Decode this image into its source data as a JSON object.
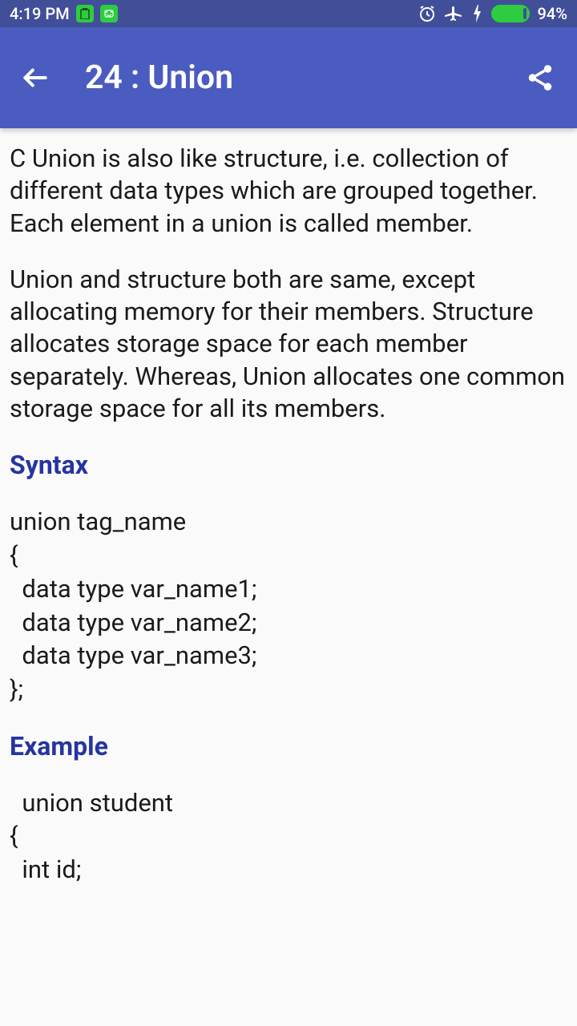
{
  "status": {
    "time": "4:19 PM",
    "battery_text": "94%"
  },
  "appbar": {
    "title": "24 :  Union"
  },
  "content": {
    "para1": "C Union is also like structure, i.e. collection of different data types which are grouped together. Each element in a union is called member.",
    "para2": "Union and structure both are same, except allocating memory for their members. Structure allocates storage space for each member separately. Whereas, Union allocates one common storage space for all its members.",
    "syntax_heading": "Syntax",
    "syntax_l1": "union tag_name",
    "syntax_l2": "{",
    "syntax_l3": "  data type var_name1;",
    "syntax_l4": "  data type var_name2;",
    "syntax_l5": "  data type var_name3;",
    "syntax_l6": "};",
    "example_heading": "Example",
    "example_l1": "  union student",
    "example_l2": "{",
    "example_l3": "  int id;"
  }
}
